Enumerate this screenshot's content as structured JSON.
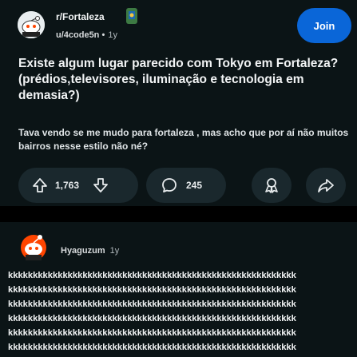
{
  "post": {
    "subreddit": "r/Fortaleza",
    "author": "u/4code5n",
    "age": "1y",
    "join_label": "Join",
    "title": "Existe algum lugar parecido com Tokyo em Fortaleza?(prédios,televisores, iluminação e tecnologia em demasia?)",
    "body": "Tava vendo se me mudo para fortaleza , mas acho que por aí não muitos bairros nesse estilo não né?",
    "upvotes": "1,763",
    "comments": "245"
  },
  "comment": {
    "author": "Hyaguzum",
    "age": "1y",
    "lines": [
      "kkkkkkkkkkkkkkkkkkkkkkkkkkkkkkkkkkkkkkkkkkkkkkkkkkkkkkkkkk",
      "kkkkkkkkkkkkkkkkkkkkkkkkkkkkkkkkkkkkkkkkkkkkkkkkkkkkkkkkkk",
      "kkkkkkkkkkkkkkkkkkkkkkkkkkkkkkkkkkkkkkkkkkkkkkkkkkkkkkkkkk",
      "kkkkkkkkkkkkkkkkkkkkkkkkkkkkkkkkkkkkkkkkkkkkkkkkkkkkkkkkkk",
      "kkkkkkkkkkkkkkkkkkkkkkkkkkkkkkkkkkkkkkkkkkkkkkkkkkkkkkkkkk",
      "kkkkkkkkkkkkkkkkkkkkkkkkkkkkkkkkkkkkkkkkkkkkkkkkkkkkkkkkkk"
    ]
  },
  "icons": {
    "upvote": "arrow-up-icon",
    "downvote": "arrow-down-icon",
    "comment": "speech-bubble-icon",
    "award": "award-icon",
    "share": "share-arrow-icon"
  },
  "colors": {
    "background": "#0b1416",
    "pill": "#1a282d",
    "join": "#0a66d8"
  }
}
